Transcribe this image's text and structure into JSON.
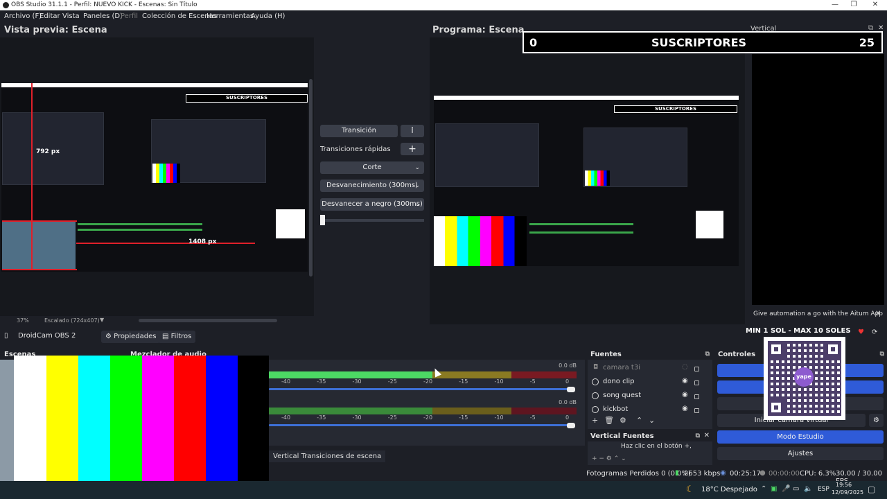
{
  "window": {
    "title": "OBS Studio 31.1.1 - Perfil: NUEVO KICK - Escenas: Sin Título",
    "controls": [
      "—",
      "❐",
      "✕"
    ]
  },
  "menu": [
    {
      "label": "Archivo (F)",
      "enabled": true
    },
    {
      "label": "Editar",
      "enabled": true
    },
    {
      "label": "Vista",
      "enabled": true
    },
    {
      "label": "Paneles (D)",
      "enabled": true
    },
    {
      "label": "Perfil",
      "enabled": false
    },
    {
      "label": "Colección de Escenas",
      "enabled": true
    },
    {
      "label": "Herramientas",
      "enabled": true
    },
    {
      "label": "Ayuda (H)",
      "enabled": true
    }
  ],
  "preview": {
    "title": "Vista previa: Escena",
    "measure_x": "792 px",
    "measure_y": "1408 px",
    "zoom": "37%",
    "scale": "Escalado (724x407)"
  },
  "program": {
    "title": "Programa: Escena"
  },
  "banner": {
    "left_value": "0",
    "label": "SUSCRIPTORES",
    "right_value": "25"
  },
  "vertical": {
    "title": "Vertical",
    "notice": "Give automation a go with the Aitum App",
    "minmax": "MIN 1 SOL - MAX 10 SOLES",
    "qr_logo": "yape"
  },
  "transition": {
    "button": "Transición",
    "quick_label": "Transiciones rápidas",
    "options": [
      "Corte",
      "Desvanecimiento (300ms)",
      "Desvanecer a negro (300ms)"
    ]
  },
  "toolbar": {
    "source_name": "DroidCam OBS 2",
    "properties": "Propiedades",
    "filters": "Filtros"
  },
  "docks": {
    "scenes": "Escenas",
    "mixer": "Mezclador de audio",
    "sources": "Fuentes",
    "vertical_sources": "Vertical Fuentes",
    "vertical_hint": "Haz clic en el botón +,",
    "vertical_transitions": "Vertical Transiciones de escena",
    "controls": "Controles"
  },
  "mixer": {
    "db_labels": [
      "0.0 dB",
      "0.0 dB"
    ],
    "ticks": [
      "-40",
      "-35",
      "-30",
      "-25",
      "-20",
      "-15",
      "-10",
      "-5",
      "0"
    ]
  },
  "sources": [
    {
      "name": "camara t3i",
      "visible": false
    },
    {
      "name": "dono clip",
      "visible": true
    },
    {
      "name": "song quest",
      "visible": true
    },
    {
      "name": "kickbot",
      "visible": true
    }
  ],
  "controls": {
    "virtual_cam": "Iniciar cámara virtual",
    "studio_mode": "Modo Estudio",
    "settings": "Ajustes"
  },
  "status": {
    "dropped": "Fotogramas Perdidos 0 (0.0%)",
    "bitrate": "2653 kbps",
    "stream_time": "00:25:17",
    "rec_time": "00:00:00",
    "cpu": "CPU: 6.3%",
    "fps": "30.00 / 30.00 FPS"
  },
  "taskbar": {
    "weather": "18°C Despejado",
    "lang": "ESP",
    "time": "19:56",
    "date": "12/09/2025"
  },
  "colors": {
    "bars": [
      "#ffffff",
      "#ffff00",
      "#00ffff",
      "#00ff00",
      "#ff00ff",
      "#ff0000",
      "#0000ff",
      "#000000"
    ],
    "accent_blue": "#2f5bd8",
    "meter_green": "#4cd964",
    "meter_yellow": "#8a7a22",
    "meter_red": "#7a1a22"
  }
}
